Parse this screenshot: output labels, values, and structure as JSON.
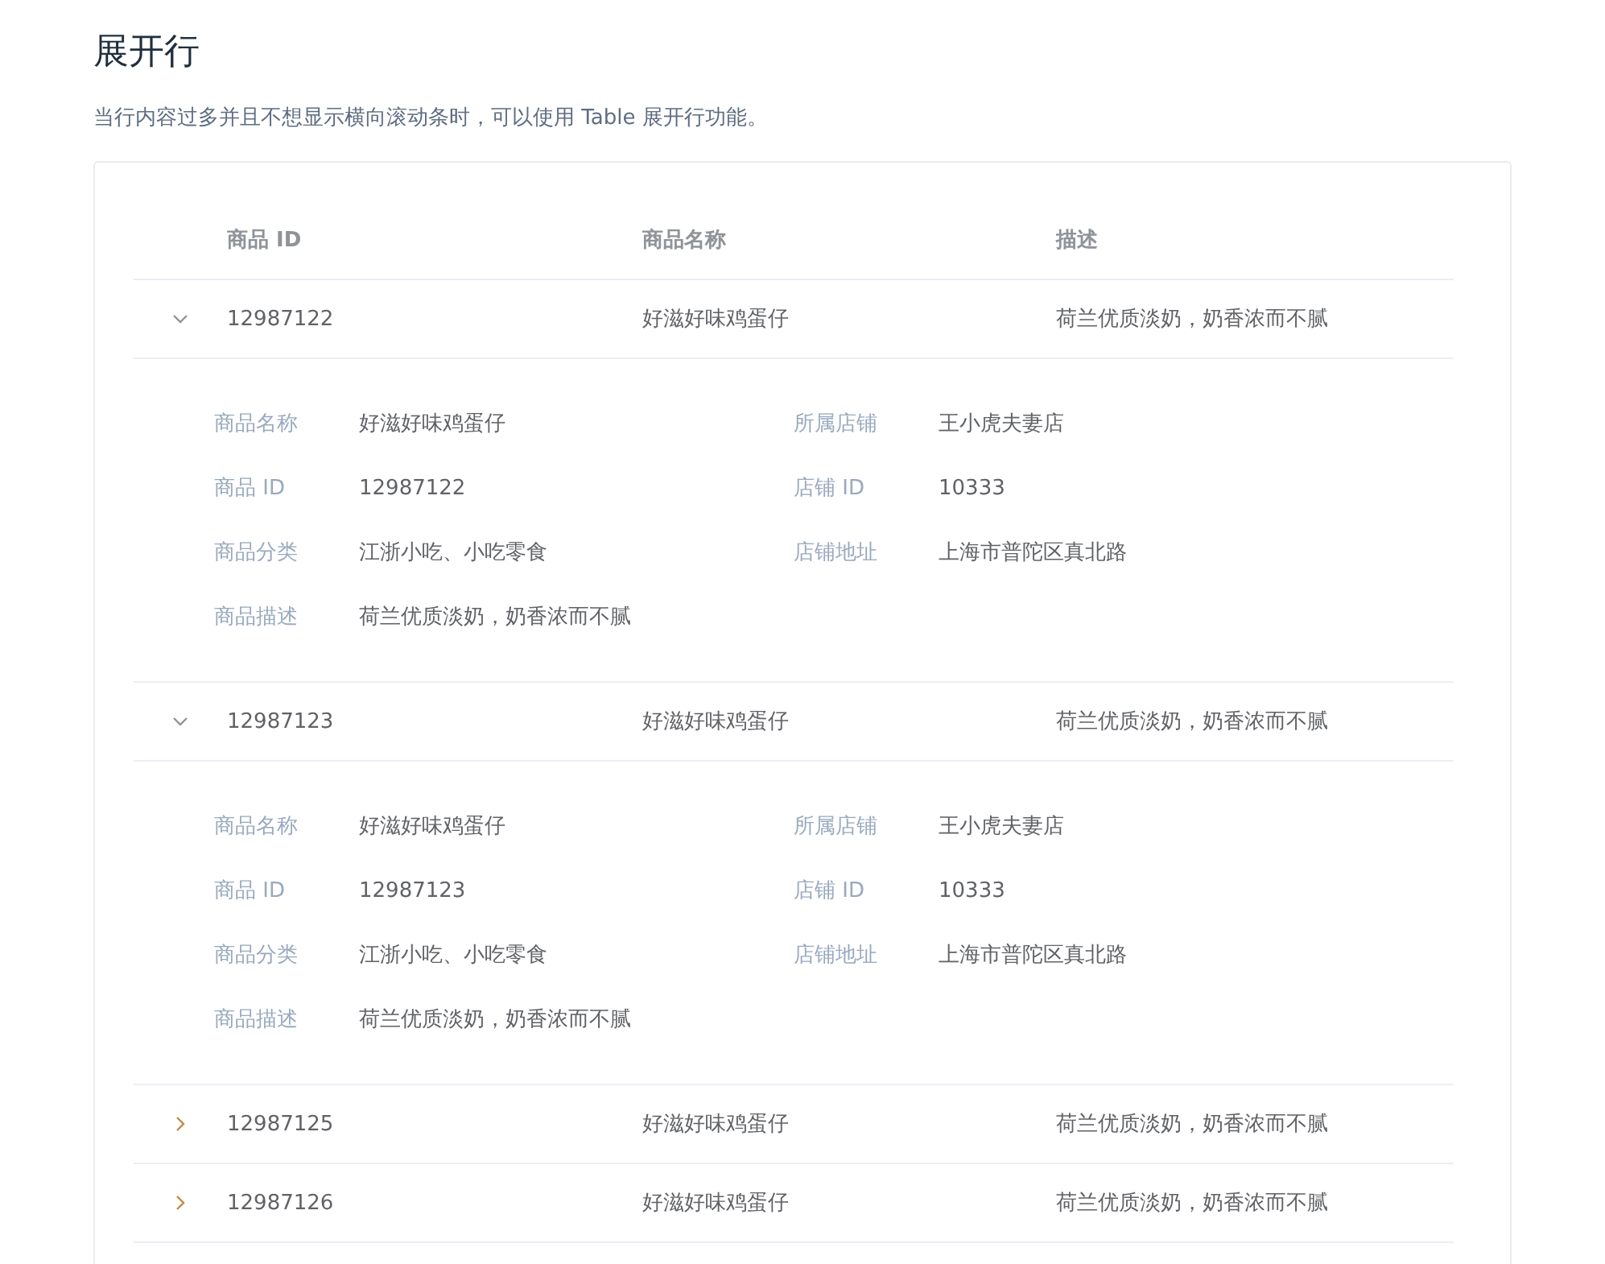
{
  "title": "展开行",
  "description": "当行内容过多并且不想显示横向滚动条时，可以使用 Table 展开行功能。",
  "table": {
    "columns": [
      "商品 ID",
      "商品名称",
      "描述"
    ],
    "rows": [
      {
        "cells": [
          "12987122",
          "好滋好味鸡蛋仔",
          "荷兰优质淡奶，奶香浓而不腻"
        ],
        "expanded": true,
        "details": [
          {
            "label": "商品名称",
            "value": "好滋好味鸡蛋仔"
          },
          {
            "label": "所属店铺",
            "value": "王小虎夫妻店"
          },
          {
            "label": "商品 ID",
            "value": "12987122"
          },
          {
            "label": "店铺 ID",
            "value": "10333"
          },
          {
            "label": "商品分类",
            "value": "江浙小吃、小吃零食"
          },
          {
            "label": "店铺地址",
            "value": "上海市普陀区真北路"
          },
          {
            "label": "商品描述",
            "value": "荷兰优质淡奶，奶香浓而不腻"
          }
        ]
      },
      {
        "cells": [
          "12987123",
          "好滋好味鸡蛋仔",
          "荷兰优质淡奶，奶香浓而不腻"
        ],
        "expanded": true,
        "details": [
          {
            "label": "商品名称",
            "value": "好滋好味鸡蛋仔"
          },
          {
            "label": "所属店铺",
            "value": "王小虎夫妻店"
          },
          {
            "label": "商品 ID",
            "value": "12987123"
          },
          {
            "label": "店铺 ID",
            "value": "10333"
          },
          {
            "label": "商品分类",
            "value": "江浙小吃、小吃零食"
          },
          {
            "label": "店铺地址",
            "value": "上海市普陀区真北路"
          },
          {
            "label": "商品描述",
            "value": "荷兰优质淡奶，奶香浓而不腻"
          }
        ]
      },
      {
        "cells": [
          "12987125",
          "好滋好味鸡蛋仔",
          "荷兰优质淡奶，奶香浓而不腻"
        ],
        "expanded": false
      },
      {
        "cells": [
          "12987126",
          "好滋好味鸡蛋仔",
          "荷兰优质淡奶，奶香浓而不腻"
        ],
        "expanded": false
      }
    ]
  }
}
